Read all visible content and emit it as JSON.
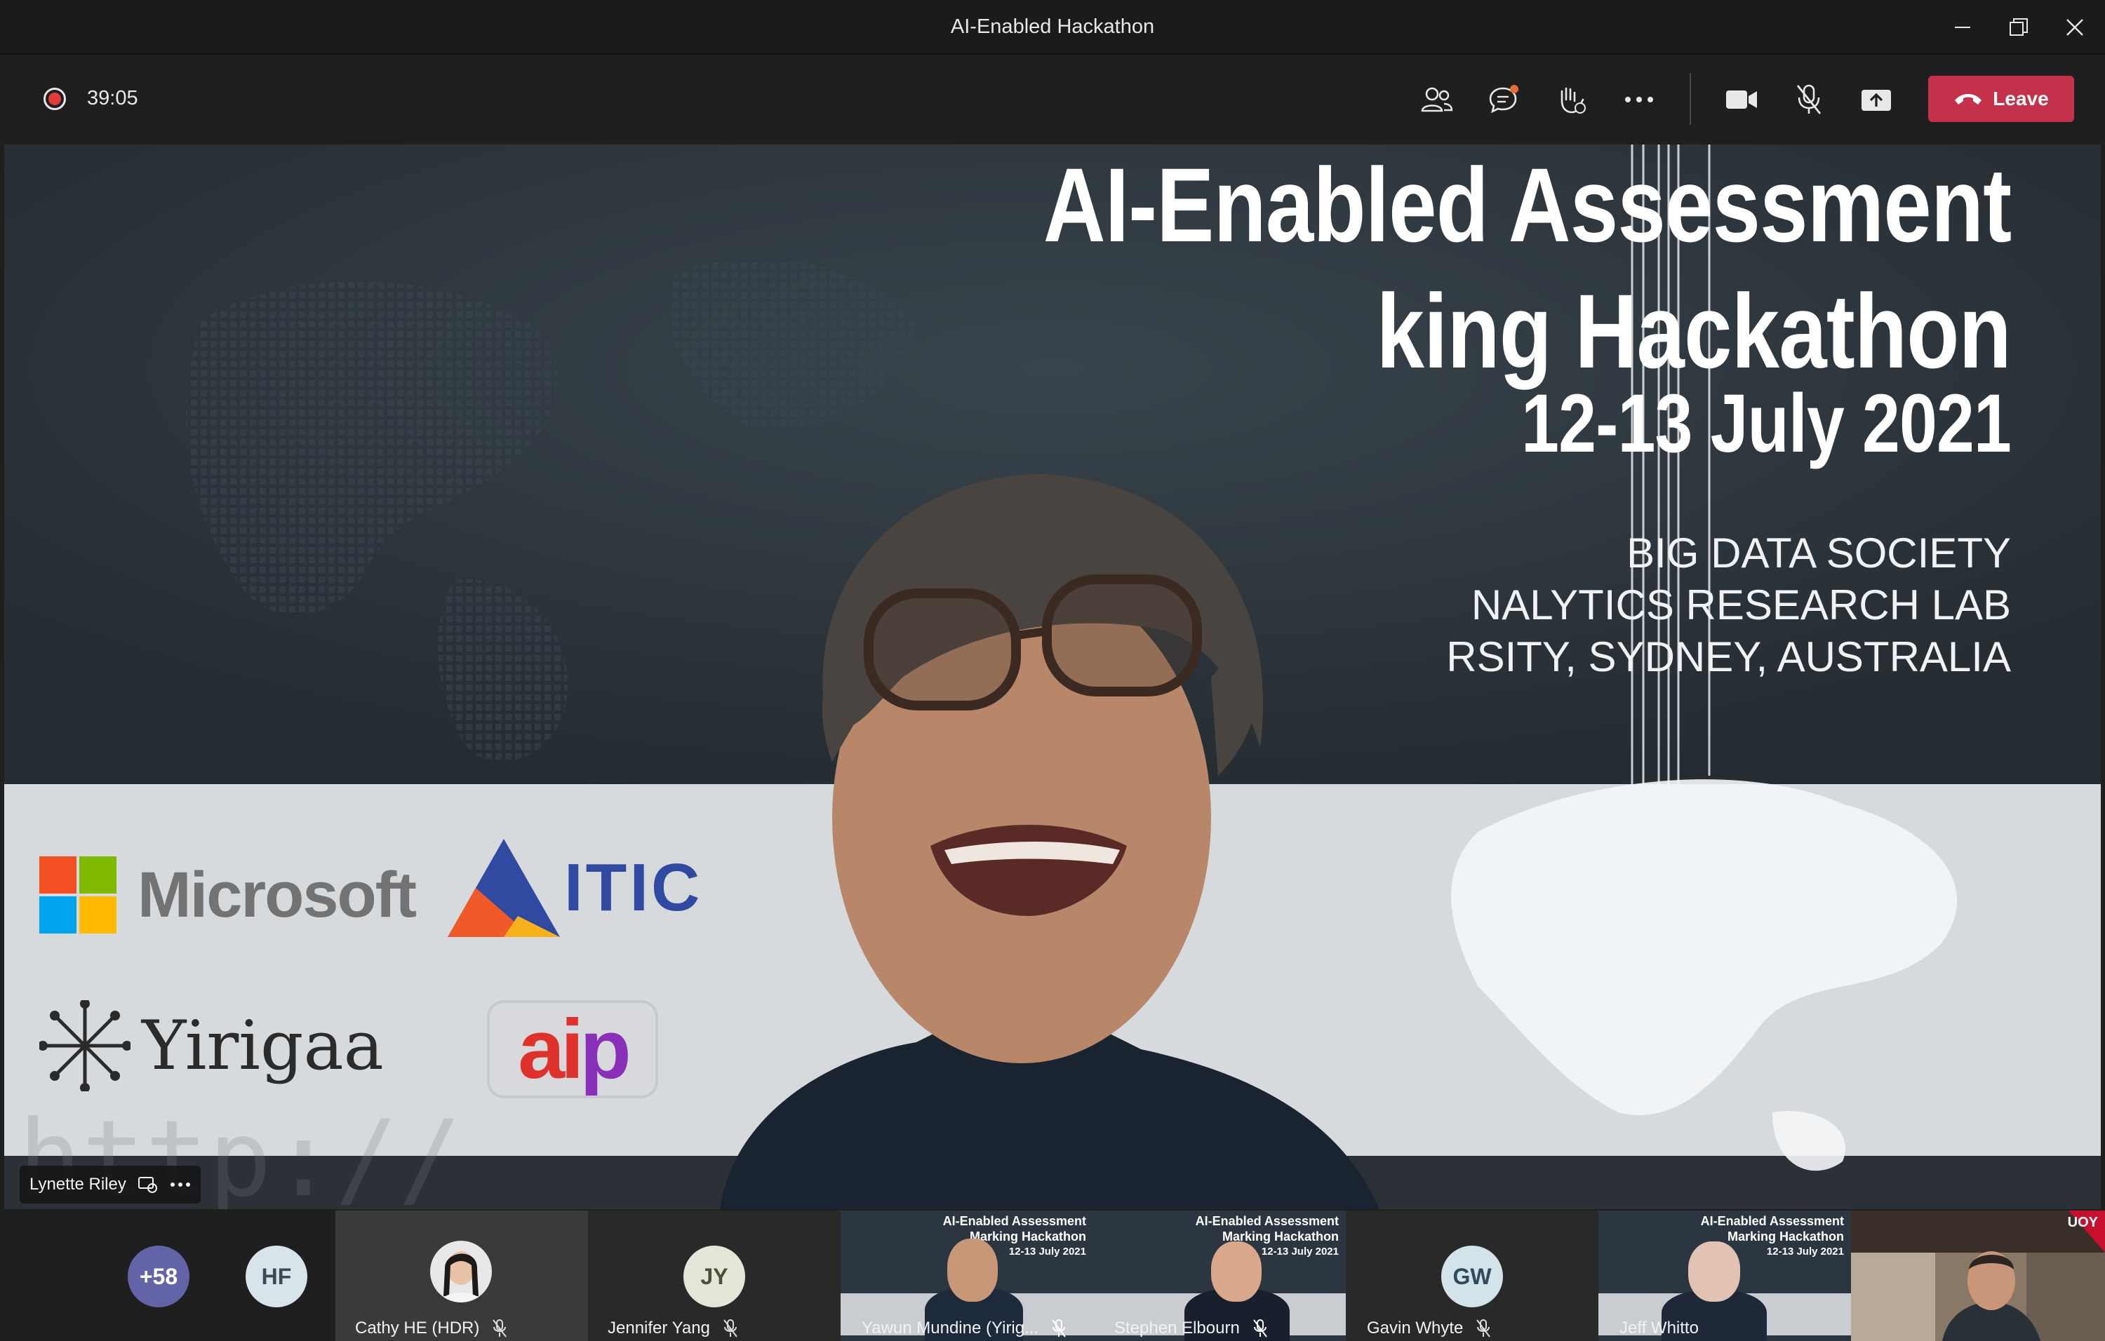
{
  "window": {
    "title": "AI-Enabled Hackathon"
  },
  "toolbar": {
    "timer": "39:05",
    "leave_label": "Leave"
  },
  "slide": {
    "title_line1": "AI-Enabled Assessment",
    "title_line2": "king Hackathon",
    "date": "12-13 July 2021",
    "org_line1": "BIG DATA SOCIETY",
    "org_line2": "NALYTICS RESEARCH LAB",
    "org_line3": "RSITY, SYDNEY, AUSTRALIA",
    "logo_microsoft": "Microsoft",
    "logo_itic": "ITIC",
    "logo_yirigaa": "Yirigaa",
    "logo_aip_a": "ai",
    "logo_aip_b": "p",
    "watermark": "http://"
  },
  "speaker": {
    "name": "Lynette Riley"
  },
  "participants": {
    "overflow": "+58",
    "tiles": [
      {
        "initials": "HF",
        "name": ""
      },
      {
        "initials": "",
        "name": "Cathy HE (HDR)"
      },
      {
        "initials": "JY",
        "name": "Jennifer Yang"
      },
      {
        "initials": "",
        "name": "Yawun Mundine (Yirig..."
      },
      {
        "initials": "",
        "name": "Stephen Elbourn"
      },
      {
        "initials": "GW",
        "name": "Gavin Whyte"
      },
      {
        "initials": "",
        "name": "Jeff Whitto"
      },
      {
        "initials": "",
        "name": ""
      }
    ],
    "mini_slide": {
      "line1": "AI-Enabled Assessment",
      "line2": "Marking Hackathon",
      "line3": "12-13 July 2021"
    },
    "uoy_badge": "UOY"
  },
  "colors": {
    "leave_button": "#c4314b",
    "record_dot": "#e23b3b",
    "overflow_avatar": "#6264a7",
    "avatar_light": "#d8e4ea"
  }
}
